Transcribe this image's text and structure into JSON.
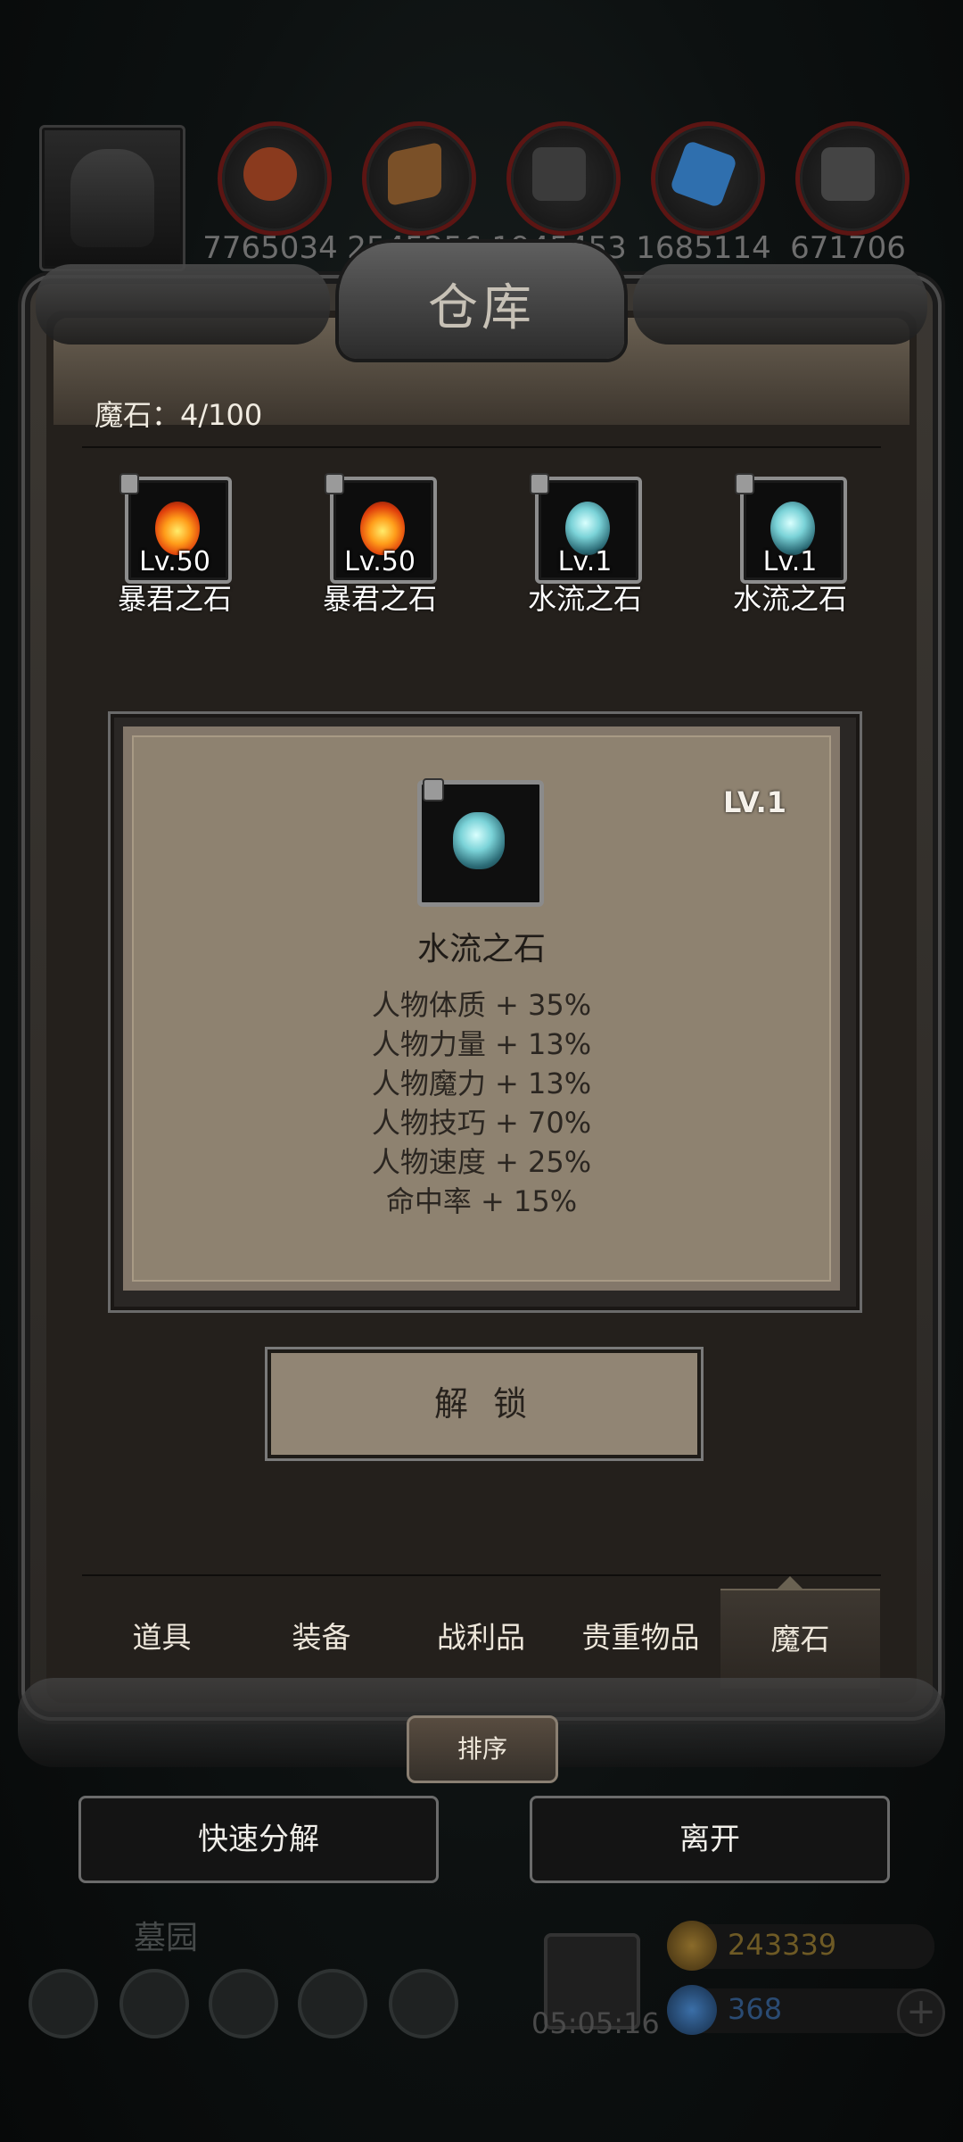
{
  "resources": [
    {
      "icon": "meat-icon",
      "value": "7765034"
    },
    {
      "icon": "wood-icon",
      "value": "2545256"
    },
    {
      "icon": "stone-icon",
      "value": "1945453"
    },
    {
      "icon": "crystal-icon",
      "value": "1685114"
    },
    {
      "icon": "iron-icon",
      "value": "671706"
    }
  ],
  "panel": {
    "title": "仓库",
    "magic_count": "魔石：4/100"
  },
  "stones": [
    {
      "level": "Lv.50",
      "name": "暴君之石",
      "type": "fire"
    },
    {
      "level": "Lv.50",
      "name": "暴君之石",
      "type": "fire"
    },
    {
      "level": "Lv.1",
      "name": "水流之石",
      "type": "water"
    },
    {
      "level": "Lv.1",
      "name": "水流之石",
      "type": "water"
    }
  ],
  "detail": {
    "level": "LV.1",
    "name": "水流之石",
    "stats": [
      "人物体质 + 35%",
      "人物力量 + 13%",
      "人物魔力 + 13%",
      "人物技巧 + 70%",
      "人物速度 + 25%",
      "命中率 + 15%"
    ],
    "unlock_label": "解 锁"
  },
  "tabs": [
    "道具",
    "装备",
    "战利品",
    "贵重物品",
    "魔石"
  ],
  "active_tab": "魔石",
  "sort_label": "排序",
  "buttons": {
    "quick_decompose": "快速分解",
    "leave": "离开"
  },
  "hud": {
    "area_name": "墓园",
    "timer": "05:05:16",
    "gold": "243339",
    "gems": "368",
    "plus": "+"
  },
  "colors": {
    "gold_text": "#6e5a25",
    "gem_text": "#2a4b73"
  }
}
